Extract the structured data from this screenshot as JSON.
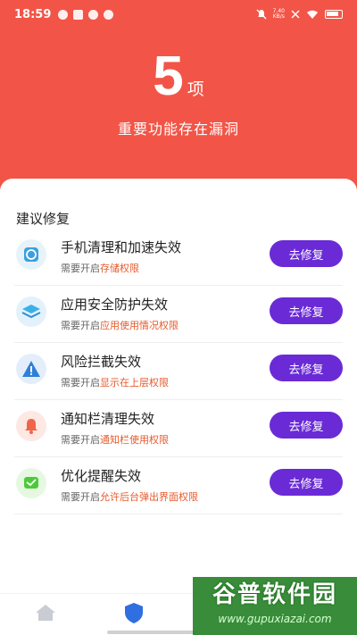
{
  "status_bar": {
    "time": "18:59",
    "net_speed_value": "7.40",
    "net_speed_unit": "KB/s"
  },
  "header": {
    "count": "5",
    "unit": "项",
    "subtitle": "重要功能存在漏洞"
  },
  "section_title": "建议修复",
  "desc_prefix": "需要开启",
  "items": [
    {
      "title": "手机清理和加速失效",
      "permission": "存储权限",
      "button": "去修复",
      "icon": "cleaner-shield-icon"
    },
    {
      "title": "应用安全防护失效",
      "permission": "应用使用情况权限",
      "button": "去修复",
      "icon": "app-layers-icon"
    },
    {
      "title": "风险拦截失效",
      "permission": "显示在上层权限",
      "button": "去修复",
      "icon": "warning-triangle-icon"
    },
    {
      "title": "通知栏清理失效",
      "permission": "通知栏使用权限",
      "button": "去修复",
      "icon": "bell-icon"
    },
    {
      "title": "优化提醒失效",
      "permission": "允许后台弹出界面权限",
      "button": "去修复",
      "icon": "message-icon"
    }
  ],
  "nav": {
    "items": [
      "home-icon",
      "shield-icon"
    ]
  },
  "watermark": {
    "title": "谷普软件园",
    "url": "www.gupuxiazai.com"
  },
  "colors": {
    "header_bg": "#f25547",
    "button_bg": "#6a2bd6",
    "link": "#e65a2c"
  }
}
